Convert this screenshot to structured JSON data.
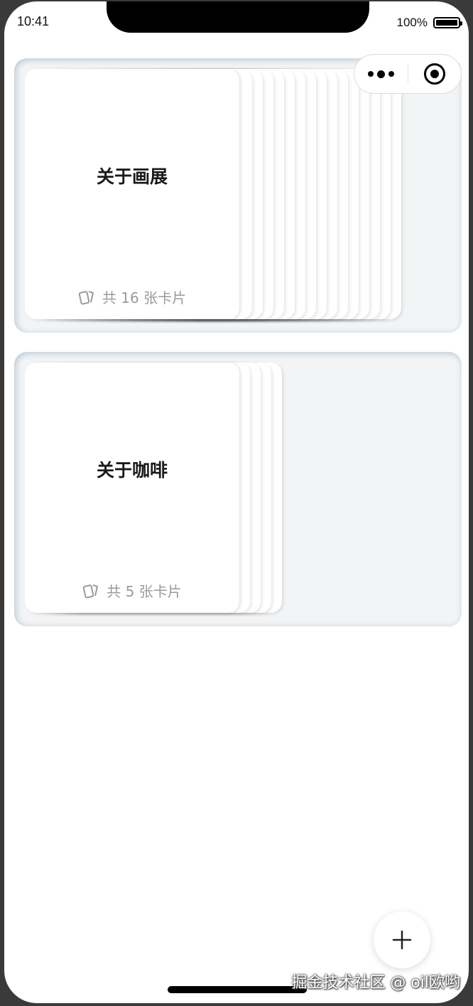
{
  "status_bar": {
    "time": "10:41",
    "battery_percent": "100%"
  },
  "capsule": {
    "more_icon": "ellipsis-icon",
    "close_icon": "target-icon"
  },
  "decks": [
    {
      "title": "关于画展",
      "count_text": "共 16 张卡片",
      "card_count": 16
    },
    {
      "title": "关于咖啡",
      "count_text": "共 5 张卡片",
      "card_count": 5
    }
  ],
  "fab": {
    "icon": "plus-icon"
  },
  "watermark": "掘金技术社区 @ oil欧哟"
}
